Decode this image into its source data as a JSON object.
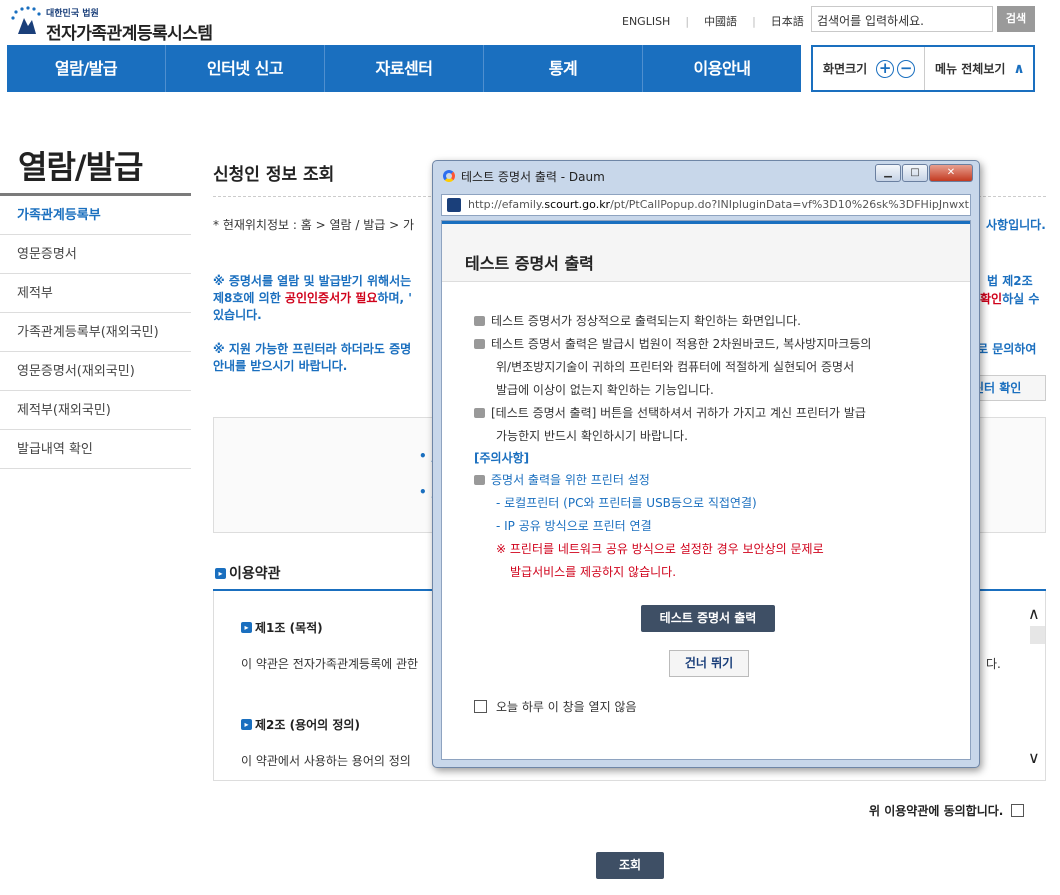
{
  "header": {
    "logo_sub": "대한민국 법원",
    "logo_main": "전자가족관계등록시스템",
    "languages": [
      "ENGLISH",
      "中國語",
      "日本語"
    ],
    "search_placeholder": "검색어를 입력하세요.",
    "search_button": "검색"
  },
  "gnb": [
    "열람/발급",
    "인터넷 신고",
    "자료센터",
    "통계",
    "이용안내"
  ],
  "tools": {
    "zoom_label": "화면크기",
    "zoom_in": "+",
    "zoom_out": "−",
    "all_menu": "메뉴 전체보기"
  },
  "lnb": {
    "title": "열람/발급",
    "items": [
      "가족관계등록부",
      "영문증명서",
      "제적부",
      "가족관계등록부(재외국민)",
      "영문증명서(재외국민)",
      "제적부(재외국민)",
      "발급내역 확인"
    ],
    "active_index": 0
  },
  "main": {
    "page_title": "신청인 정보 조회",
    "location": "* 현재위치정보 : 홈 > 열람 / 발급 > 가",
    "location_right": "사항입니다.",
    "notice1_line1": "※ 증명서를 열람 및 발급받기 위해서는",
    "notice1_line2_a": "제8호에 의한 ",
    "notice1_line2_red": "공인인증서가 필요",
    "notice1_line2_b": "하며, '",
    "notice1_line3": "있습니다.",
    "notice1_right1": "법 제2조",
    "notice1_right2_red": "확인",
    "notice1_right2_b": "하실 수",
    "notice2_line1": "※ 지원 가능한 프린터라 하더라도 증명",
    "notice2_line2": "안내를 받으시기 바랍니다.",
    "notice2_right": "로 문의하여",
    "printer_button": "린터 확인",
    "bullet1": "• ,",
    "bullet2": "• ;",
    "terms_title": "이용약관",
    "article1_title": "제1조 (목적)",
    "article1_text": "이 약관은 전자가족관계등록에 관한",
    "article1_right": "다.",
    "article2_title": "제2조 (용어의 정의)",
    "article2_text": "이 약관에서 사용하는 용어의 정의",
    "agree_label": "위 이용약관에 동의합니다.",
    "submit_button": "조회"
  },
  "popup": {
    "window_title": "테스트 증명서 출력 - Daum",
    "url_prefix": "http://efamily.",
    "url_domain": "scourt.go.kr",
    "url_rest": "/pt/PtCallPopup.do?INIpluginData=vf%3D10%26sk%3DFHipJnwxt",
    "title": "테스트 증명서 출력",
    "p1": "테스트 증명서가 정상적으로 출력되는지 확인하는 화면입니다.",
    "p2_line1": "테스트 증명서 출력은 발급시 법원이 적용한 2차원바코드, 복사방지마크등의",
    "p2_line2": "위/변조방지기술이 귀하의 프린터와 컴퓨터에 적절하게 실현되어 증명서",
    "p2_line3": "발급에 이상이 없는지 확인하는 기능입니다.",
    "p3_line1": "[테스트 증명서 출력] 버튼을 선택하셔서 귀하가 가지고 계신 프린터가 발급",
    "p3_line2": "가능한지 반드시 확인하시기 바랍니다.",
    "caution_title": "[주의사항]",
    "caution_head": "증명서 출력을 위한 프린터 설정",
    "caution_item1": "- 로컬프린터 (PC와 프린터를 USB등으로 직접연결)",
    "caution_item2": "- IP 공유 방식으로 프린터 연결",
    "warning_line1": "※ 프린터를 네트워크 공유 방식으로 설정한 경우 보안상의 문제로",
    "warning_line2": "발급서비스를 제공하지 않습니다.",
    "print_button": "테스트 증명서 출력",
    "skip_button": "건너 뛰기",
    "no_show_label": "오늘 하루 이 창을 열지 않음"
  },
  "colors": {
    "brand_blue": "#1a6fbf",
    "dark_button": "#3e4f65",
    "warning_red": "#d0021b"
  }
}
